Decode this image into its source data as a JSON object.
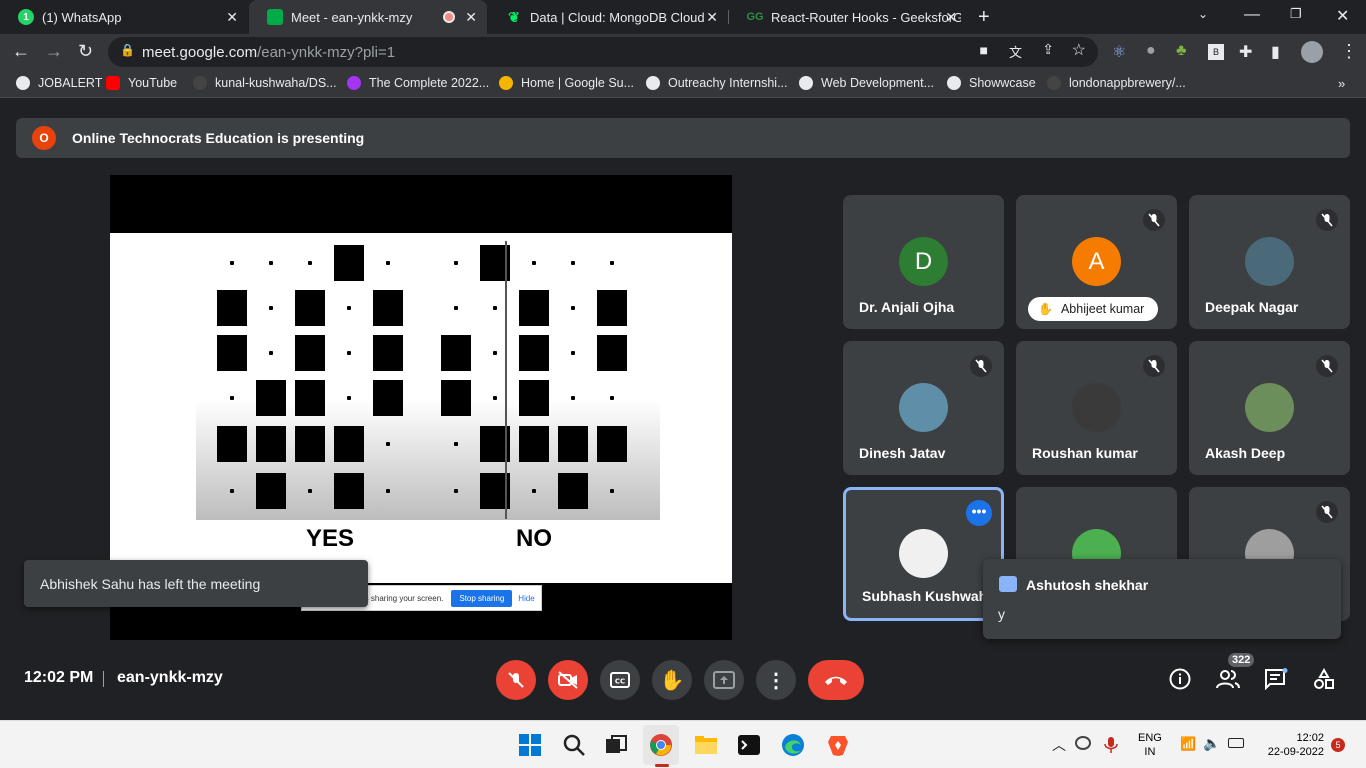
{
  "browser": {
    "tabs": [
      {
        "title": "(1) WhatsApp",
        "favicon": "whatsapp-icon",
        "color": "#25d366"
      },
      {
        "title": "Meet - ean-ynkk-mzy",
        "favicon": "meet-icon",
        "color": "#00ac47",
        "active": true
      },
      {
        "title": "Data | Cloud: MongoDB Cloud",
        "favicon": "mongodb-icon",
        "color": "#00ed64"
      },
      {
        "title": "React-Router Hooks - GeeksforG",
        "favicon": "gfg-icon",
        "color": "#2f8d46"
      }
    ],
    "url_host": "meet.google.com",
    "url_path": "/ean-ynkk-mzy?pli=1",
    "bookmarks": [
      {
        "label": "JOBALERT",
        "color": "#ffffff"
      },
      {
        "label": "YouTube",
        "color": "#ff0000"
      },
      {
        "label": "kunal-kushwaha/DS...",
        "color": "#222222"
      },
      {
        "label": "The Complete 2022...",
        "color": "#a435f0"
      },
      {
        "label": "Home | Google Su...",
        "color": "#f4b400"
      },
      {
        "label": "Outreachy Internshi...",
        "color": "#ffffff"
      },
      {
        "label": "Web Development...",
        "color": "#ffffff"
      },
      {
        "label": "Showwcase",
        "color": "#ffffff"
      },
      {
        "label": "londonappbrewery/...",
        "color": "#222222"
      }
    ]
  },
  "meet": {
    "banner_icon_letter": "O",
    "banner_text": "Online Technocrats Education is presenting",
    "slide": {
      "yes_label": "YES",
      "no_label": "NO"
    },
    "share_bar": {
      "text": "m is sharing your screen.",
      "stop_label": "Stop sharing",
      "hide_label": "Hide"
    },
    "toast": "Abhishek Sahu has left the meeting",
    "participants": [
      {
        "name": "Dr. Anjali Ojha",
        "initial": "D",
        "avatar_color": "#2d7d32",
        "muted": false
      },
      {
        "name": "Abhijeet kumar",
        "initial": "A",
        "avatar_color": "#f57c00",
        "muted": true,
        "hand_raised": true
      },
      {
        "name": "Deepak Nagar",
        "initial": "",
        "avatar_color": "#4a6a7a",
        "muted": true
      },
      {
        "name": "Dinesh Jatav",
        "initial": "",
        "avatar_color": "#5f8fa8",
        "muted": true
      },
      {
        "name": "Roushan kumar",
        "initial": "",
        "avatar_color": "#3a3a3a",
        "muted": true
      },
      {
        "name": "Akash Deep",
        "initial": "",
        "avatar_color": "#6b8e5a",
        "muted": true
      },
      {
        "name": "Subhash Kushwaha",
        "initial": "",
        "avatar_color": "#f0f0f0",
        "muted": false,
        "selected": true
      },
      {
        "name": "",
        "initial": "",
        "avatar_color": "#4caf50",
        "muted": false
      },
      {
        "name": "",
        "initial": "",
        "avatar_color": "#9e9e9e",
        "muted": true
      }
    ],
    "chat": {
      "sender": "Ashutosh shekhar",
      "message": "y"
    },
    "time": "12:02 PM",
    "meeting_code": "ean-ynkk-mzy",
    "people_count": "322"
  },
  "taskbar": {
    "lang_line1": "ENG",
    "lang_line2": "IN",
    "time": "12:02",
    "date": "22-09-2022",
    "notifications": "5"
  }
}
